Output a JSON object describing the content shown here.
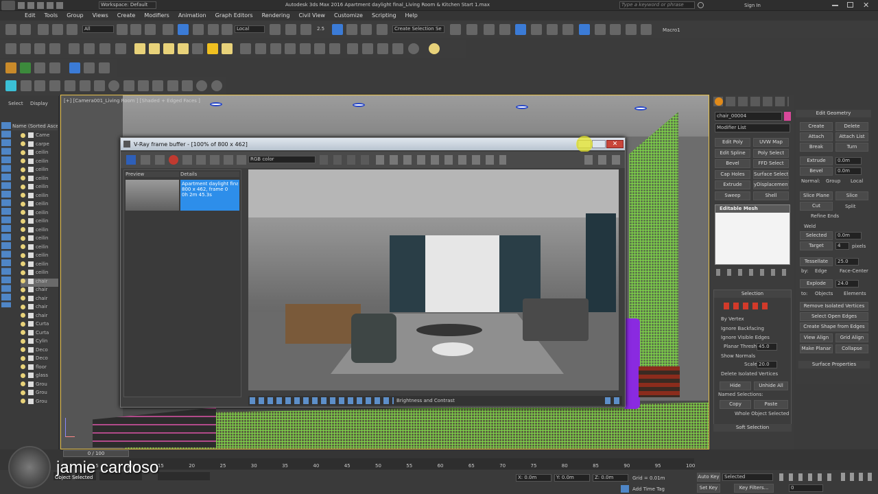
{
  "window": {
    "workspace": "Workspace: Default",
    "title": "Autodesk 3ds Max 2016   Apartment daylight final_Living Room & Kitchen Start 1.max",
    "search_placeholder": "Type a keyword or phrase",
    "signin": "Sign In"
  },
  "menu": [
    "Edit",
    "Tools",
    "Group",
    "Views",
    "Create",
    "Modifiers",
    "Animation",
    "Graph Editors",
    "Rendering",
    "Civil View",
    "Customize",
    "Scripting",
    "Help"
  ],
  "toolbar": {
    "filter": "All",
    "coord": "Local",
    "snap_value": "2.5",
    "named_sel": "Create Selection Se",
    "macro": "Macro1"
  },
  "scene_explorer": {
    "tab_select": "Select",
    "tab_display": "Display",
    "column": "Name (Sorted Ascer",
    "items": [
      "Came",
      "carpe",
      "ceilin",
      "ceilin",
      "ceilin",
      "ceilin",
      "ceilin",
      "ceilin",
      "ceilin",
      "ceilin",
      "ceilin",
      "ceilin",
      "ceilin",
      "ceilin",
      "ceilin",
      "ceilin",
      "ceilin",
      "chair",
      "chair",
      "chair",
      "chair",
      "chair",
      "Curta",
      "Curta",
      "Cylin",
      "Deco",
      "Deco",
      "floor",
      "glass",
      "Grou",
      "Grou",
      "Grou"
    ]
  },
  "viewport": {
    "label": "[+] [Camera001_Living Room ] [Shaded + Edged Faces ]"
  },
  "vfb": {
    "title": "V-Ray frame buffer - [100% of 800 x 462]",
    "channel": "RGB color",
    "preview_header": "Preview",
    "details_header": "Details",
    "detail_line1": "Apartment daylight final_",
    "detail_line2": "800 x 462, frame 0",
    "detail_line3": "0h 2m 45.3s",
    "status": "Brightness and Contrast"
  },
  "command_panel": {
    "object_name": "chair_00004",
    "modifier_list": "Modifier List",
    "modifiers": [
      "Edit Poly",
      "UVW Map",
      "Edit Spline",
      "Poly Select",
      "Bevel",
      "FFD Select",
      "Cap Holes",
      "Surface Select",
      "Extrude",
      "yDisplacement",
      "Sweep",
      "Shell"
    ],
    "stack_item": "Editable Mesh",
    "selection_title": "Selection",
    "by_vertex": "By Vertex",
    "ignore_backfacing": "Ignore Backfacing",
    "ignore_visible_edges": "Ignore Visible Edges",
    "planar_thresh": "Planar Thresh:",
    "planar_val": "45.0",
    "show_normals": "Show Normals",
    "scale": "Scale:",
    "scale_val": "20.0",
    "delete_isolated": "Delete Isolated Vertices",
    "hide": "Hide",
    "unhide_all": "Unhide All",
    "named_selections": "Named Selections:",
    "copy": "Copy",
    "paste": "Paste",
    "whole_object_selected": "Whole Object Selected",
    "soft_selection": "Soft Selection"
  },
  "edit_geometry": {
    "title": "Edit Geometry",
    "create": "Create",
    "delete": "Delete",
    "attach": "Attach",
    "attach_list": "Attach List",
    "break": "Break",
    "turn": "Turn",
    "extrude": "Extrude",
    "extrude_val": "0.0m",
    "bevel": "Bevel",
    "bevel_val": "0.0m",
    "normal": "Normal:",
    "group": "Group",
    "local": "Local",
    "slice_plane": "Slice Plane",
    "slice": "Slice",
    "cut": "Cut",
    "split": "Split",
    "refine_ends": "Refine Ends",
    "weld": "Weld",
    "selected": "Selected",
    "selected_val": "0.0m",
    "target": "Target",
    "target_val": "4",
    "pixels": "pixels",
    "tessellate": "Tessellate",
    "tess_val": "25.0",
    "by": "by:",
    "edge": "Edge",
    "face_center": "Face-Center",
    "explode": "Explode",
    "explode_val": "24.0",
    "to": "to:",
    "objects": "Objects",
    "elements": "Elements",
    "remove_isolated": "Remove Isolated Vertices",
    "select_open_edges": "Select Open Edges",
    "create_shape": "Create Shape from Edges",
    "view_align": "View Align",
    "grid_align": "Grid Align",
    "make_planar": "Make Planar",
    "collapse": "Collapse",
    "surface_props": "Surface Properties"
  },
  "timeline": {
    "frame": "0 / 100",
    "ticks": [
      "0",
      "5",
      "10",
      "15",
      "20",
      "25",
      "30",
      "35",
      "40",
      "45",
      "50",
      "55",
      "60",
      "65",
      "70",
      "75",
      "80",
      "85",
      "90",
      "95",
      "100"
    ]
  },
  "status": {
    "x": "X: 0.0m",
    "y": "Y: 0.0m",
    "z": "Z: 0.0m",
    "grid": "Grid = 0.01m",
    "auto_key": "Auto Key",
    "selected": "Selected",
    "set_key": "Set Key",
    "key_filters": "Key Filters...",
    "add_time_tag": "Add Time Tag",
    "frame_val": "0",
    "object_selected": "Object Selected"
  },
  "presenter": "jamie cardoso"
}
